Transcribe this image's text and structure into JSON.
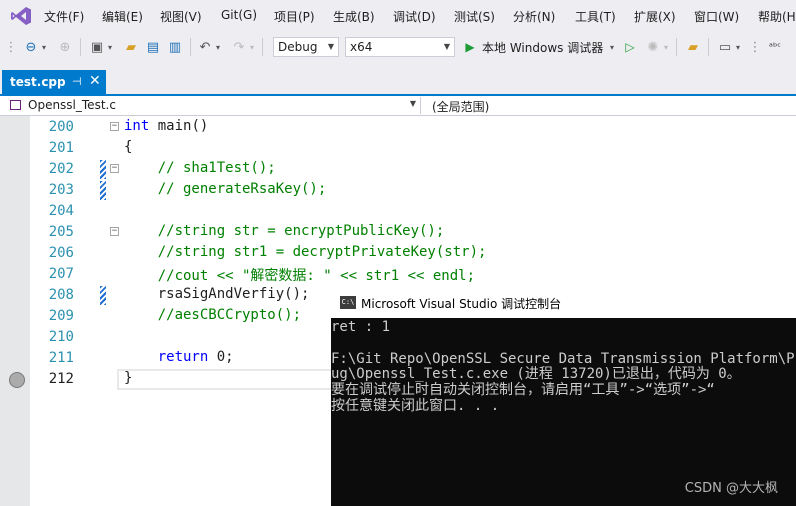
{
  "menu": {
    "items": [
      "文件(F)",
      "编辑(E)",
      "视图(V)",
      "Git(G)",
      "项目(P)",
      "生成(B)",
      "调试(D)",
      "测试(S)",
      "分析(N)",
      "工具(T)",
      "扩展(X)",
      "窗口(W)",
      "帮助(H)"
    ]
  },
  "toolbar": {
    "configuration": "Debug",
    "platform": "x64",
    "run_label": "本地 Windows 调试器"
  },
  "tab": {
    "filename": "test.cpp",
    "pin_glyph": "⊣",
    "close_glyph": "✕"
  },
  "navbar": {
    "project": "Openssl_Test.c",
    "scope": "(全局范围)"
  },
  "editor": {
    "lines": [
      {
        "num": "200",
        "code": "int main()"
      },
      {
        "num": "201",
        "code": "{"
      },
      {
        "num": "202",
        "code": "    // sha1Test();"
      },
      {
        "num": "203",
        "code": "    // generateRsaKey();"
      },
      {
        "num": "204",
        "code": ""
      },
      {
        "num": "205",
        "code": "    //string str = encryptPublicKey();"
      },
      {
        "num": "206",
        "code": "    //string str1 = decryptPrivateKey(str);"
      },
      {
        "num": "207",
        "code": "    //cout << \"解密数据: \" << str1 << endl;"
      },
      {
        "num": "208",
        "code": "    rsaSigAndVerfiy();"
      },
      {
        "num": "209",
        "code": "    //aesCBCCrypto();"
      },
      {
        "num": "210",
        "code": ""
      },
      {
        "num": "211",
        "code": "    return 0;"
      },
      {
        "num": "212",
        "code": "}"
      }
    ]
  },
  "console": {
    "title": "Microsoft Visual Studio 调试控制台",
    "icon_text": "C:\\",
    "lines": [
      "ret : 1",
      "",
      "F:\\Git Repo\\OpenSSL Secure Data Transmission Platform\\Prep",
      "ug\\Openssl_Test.c.exe (进程 13720)已退出，代码为 0。",
      "要在调试停止时自动关闭控制台，请启用“工具”->“选项”->“",
      "按任意键关闭此窗口. . ."
    ],
    "watermark": "CSDN @大大枫"
  }
}
